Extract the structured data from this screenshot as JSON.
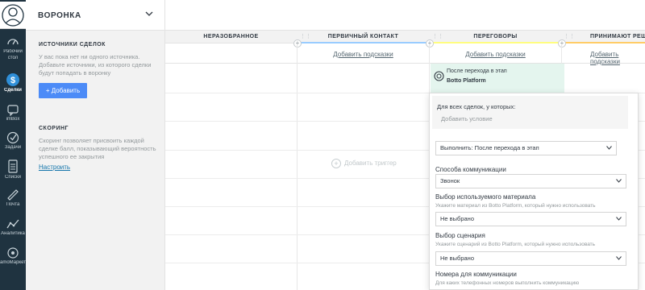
{
  "nav": {
    "items": [
      {
        "label": "Рабочий стол",
        "line2": "стол",
        "line1": "Рабочий",
        "icon": "dashboard-icon"
      },
      {
        "label": "Сделки",
        "icon": "deals-icon"
      },
      {
        "label": "imBox",
        "icon": "chat-icon"
      },
      {
        "label": "Задачи",
        "icon": "tasks-icon"
      },
      {
        "label": "Списки",
        "icon": "lists-icon"
      },
      {
        "label": "Почта",
        "icon": "mail-icon"
      },
      {
        "label": "Аналитика",
        "icon": "analytics-icon"
      },
      {
        "label": "amoМаркет",
        "icon": "market-icon"
      }
    ]
  },
  "panel": {
    "title": "ВОРОНКА",
    "sources_title": "ИСТОЧНИКИ СДЕЛОК",
    "sources_text": "У вас пока нет ни одного источника. Добавьте источники, из которого сделки будут попадать в воронку",
    "add_button": "Добавить",
    "scoring_title": "СКОРИНГ",
    "scoring_text": "Скоринг позволяет присвоить каждой сделке балл, показывающий вероятность успешного ее закрытия",
    "setup_link": "Настроить"
  },
  "board": {
    "columns": [
      {
        "title": "НЕРАЗОБРАННОЕ",
        "color": ""
      },
      {
        "title": "ПЕРВИЧНЫЙ КОНТАКТ",
        "color": "#99ccff"
      },
      {
        "title": "ПЕРЕГОВОРЫ",
        "color": "#fffd7f"
      },
      {
        "title": "ПРИНИМАЮТ РЕШЕ",
        "color": "#ffcc66"
      }
    ],
    "hint_link": "Добавить подсказки",
    "add_trigger": "Добавить триггер",
    "trigger": {
      "line1": "После перехода в этап",
      "line2": "Botto Platform"
    }
  },
  "popup": {
    "cond_title": "Для всех сделок, у которых:",
    "cond_add": "Добавить условие",
    "execute_select": "Выполнить: После перехода в этап",
    "comm_label": "Способа коммуникации",
    "comm_value": "Звонок",
    "material_label": "Выбор используемого материала",
    "material_hint": "Укажите материал из Botto Platform, который нужно использовать",
    "material_value": "Не выбрано",
    "scenario_label": "Выбор сценария",
    "scenario_hint": "Укажите сценарий из Botto Platform, который нужно использовать",
    "scenario_value": "Не выбрано",
    "numbers_label": "Номера для коммуникации",
    "numbers_hint": "Для каких телефонных номеров выполнить коммуникацию"
  }
}
